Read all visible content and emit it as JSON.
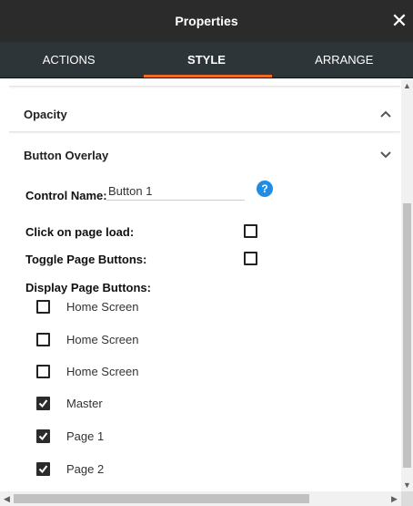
{
  "window": {
    "title": "Properties",
    "close_glyph": "✕"
  },
  "tabs": [
    {
      "label": "ACTIONS",
      "active": false
    },
    {
      "label": "STYLE",
      "active": true
    },
    {
      "label": "ARRANGE",
      "active": false
    }
  ],
  "sections": {
    "opacity": {
      "title": "Opacity",
      "expanded": false
    },
    "button_overlay": {
      "title": "Button Overlay",
      "expanded": true
    }
  },
  "form": {
    "control_name_label": "Control Name:",
    "control_name_value": "Button 1",
    "help_glyph": "?",
    "click_on_load_label": "Click on page load:",
    "click_on_load_checked": false,
    "toggle_page_buttons_label": "Toggle Page Buttons:",
    "toggle_page_buttons_checked": false,
    "display_page_buttons_label": "Display Page Buttons:"
  },
  "page_buttons": [
    {
      "label": "Home Screen",
      "checked": false
    },
    {
      "label": "Home Screen",
      "checked": false
    },
    {
      "label": "Home Screen",
      "checked": false
    },
    {
      "label": "Master",
      "checked": true
    },
    {
      "label": "Page 1",
      "checked": true
    },
    {
      "label": "Page 2",
      "checked": true
    }
  ],
  "colors": {
    "accent": "#f26a21",
    "titlebar": "#2b2b2b",
    "tabs": "#2e3538",
    "help": "#1f8ce6"
  }
}
